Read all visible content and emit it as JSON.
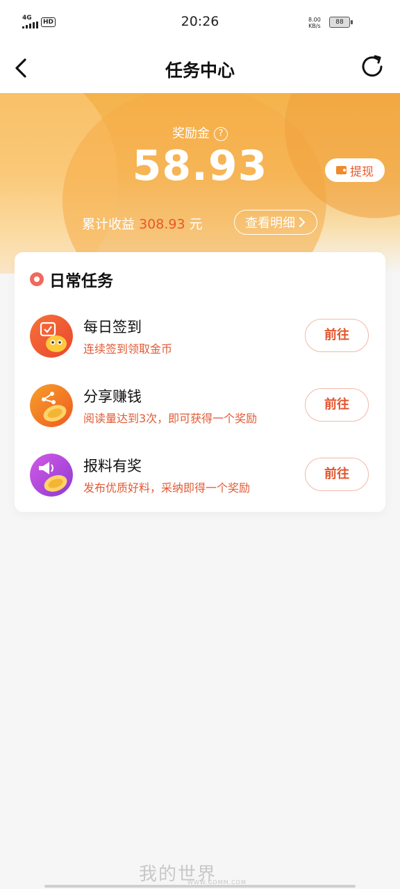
{
  "status_bar": {
    "signal": "4G",
    "hd": "HD",
    "time": "20:26",
    "speed_value": "8.00",
    "speed_unit": "KB/s",
    "battery": "88"
  },
  "nav": {
    "title": "任务中心"
  },
  "reward": {
    "label": "奖励金",
    "amount": "58.93",
    "withdraw_label": "提现",
    "earnings_label": "累计收益",
    "earnings_amount": "308.93",
    "earnings_unit": "元",
    "detail_label": "查看明细"
  },
  "daily_tasks": {
    "title": "日常任务",
    "items": [
      {
        "name": "每日签到",
        "desc": "连续签到领取金币",
        "button": "前往",
        "icon": "calendar-coin-icon",
        "color": "#ef5a34"
      },
      {
        "name": "分享赚钱",
        "desc": "阅读量达到3次，即可获得一个奖励",
        "button": "前往",
        "icon": "share-coin-icon",
        "color": "#f07a22"
      },
      {
        "name": "报料有奖",
        "desc": "发布优质好料，采纳即得一个奖励",
        "button": "前往",
        "icon": "megaphone-coin-icon",
        "color": "#b04ad6"
      }
    ]
  },
  "watermark": {
    "text": "我的世界",
    "url": "WWW.GDMM.COM"
  }
}
